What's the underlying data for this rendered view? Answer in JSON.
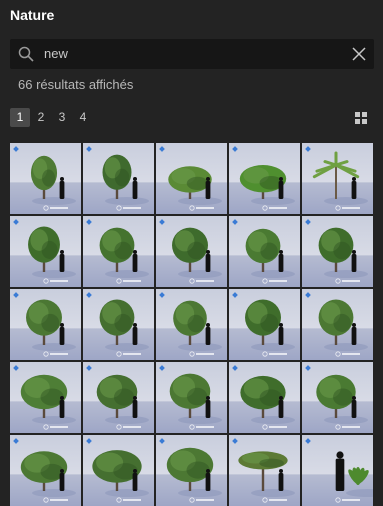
{
  "panel": {
    "title": "Nature",
    "search": {
      "value": "new",
      "placeholder": ""
    },
    "results_text": "66 résultats affichés",
    "pages": [
      "1",
      "2",
      "3",
      "4"
    ],
    "active_page": "1"
  },
  "tiles": [
    {
      "type": "tree",
      "h": 0.78,
      "w": 0.45,
      "c": "#4e7a34"
    },
    {
      "type": "tree",
      "h": 0.8,
      "w": 0.5,
      "c": "#3f6a2e"
    },
    {
      "type": "tree",
      "h": 0.6,
      "w": 0.75,
      "c": "#5a8a35"
    },
    {
      "type": "tree",
      "h": 0.62,
      "w": 0.8,
      "c": "#4f8f2f"
    },
    {
      "type": "palm",
      "h": 0.7,
      "w": 0.6,
      "c": "#6fa042"
    },
    {
      "type": "tree",
      "h": 0.82,
      "w": 0.55,
      "c": "#3f6d2b"
    },
    {
      "type": "tree",
      "h": 0.8,
      "w": 0.6,
      "c": "#45732f"
    },
    {
      "type": "tree",
      "h": 0.8,
      "w": 0.62,
      "c": "#3e6b2c"
    },
    {
      "type": "tree",
      "h": 0.78,
      "w": 0.6,
      "c": "#4a7a32"
    },
    {
      "type": "tree",
      "h": 0.8,
      "w": 0.6,
      "c": "#3f6d2b"
    },
    {
      "type": "tree",
      "h": 0.82,
      "w": 0.62,
      "c": "#4b7733"
    },
    {
      "type": "tree",
      "h": 0.82,
      "w": 0.6,
      "c": "#456f30"
    },
    {
      "type": "tree",
      "h": 0.8,
      "w": 0.58,
      "c": "#4c7833"
    },
    {
      "type": "tree",
      "h": 0.82,
      "w": 0.62,
      "c": "#3f6d2b"
    },
    {
      "type": "tree",
      "h": 0.82,
      "w": 0.6,
      "c": "#4c7833"
    },
    {
      "type": "tree",
      "h": 0.78,
      "w": 0.8,
      "c": "#4e7e36"
    },
    {
      "type": "tree",
      "h": 0.78,
      "w": 0.7,
      "c": "#456f30"
    },
    {
      "type": "tree",
      "h": 0.8,
      "w": 0.7,
      "c": "#4c7833"
    },
    {
      "type": "tree",
      "h": 0.76,
      "w": 0.78,
      "c": "#3f6d2b"
    },
    {
      "type": "tree",
      "h": 0.78,
      "w": 0.68,
      "c": "#4a7a32"
    },
    {
      "type": "tree",
      "h": 0.72,
      "w": 0.8,
      "c": "#4c7833"
    },
    {
      "type": "tree",
      "h": 0.74,
      "w": 0.85,
      "c": "#456f30"
    },
    {
      "type": "tree",
      "h": 0.78,
      "w": 0.8,
      "c": "#4c7833"
    },
    {
      "type": "baobab",
      "h": 0.7,
      "w": 0.85,
      "c": "#5c7a35"
    },
    {
      "type": "plant",
      "h": 0.5,
      "w": 0.4,
      "c": "#4e8a2e"
    }
  ],
  "colors": {
    "badge": "#3a7bd5",
    "background": "#232323"
  }
}
